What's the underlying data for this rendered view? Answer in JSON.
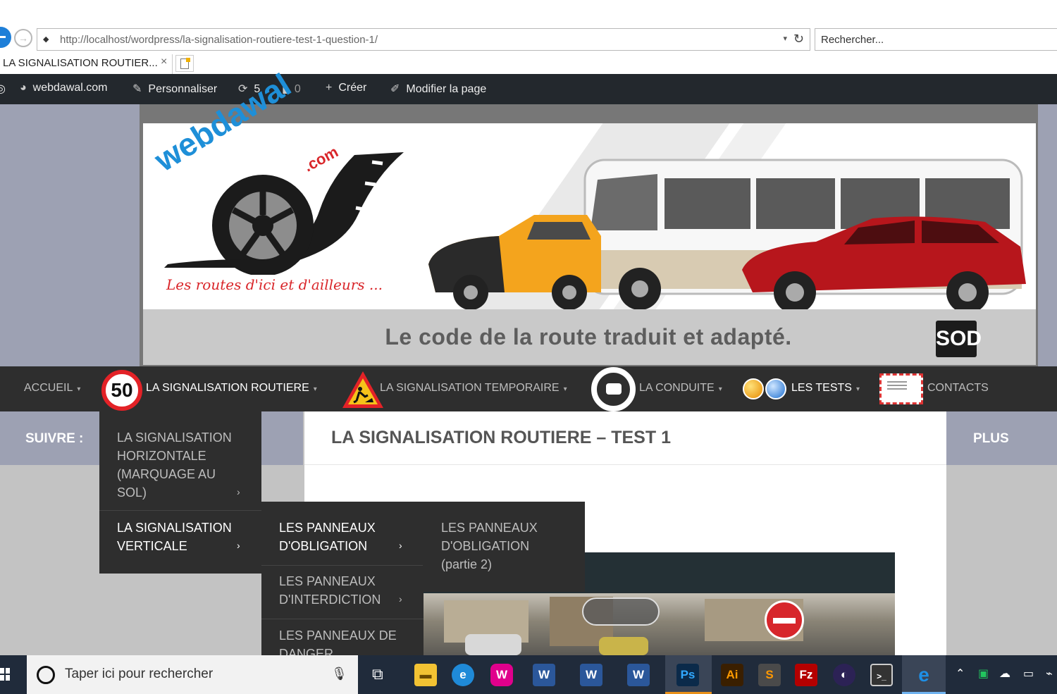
{
  "browser": {
    "url": "http://localhost/wordpress/la-signalisation-routiere-test-1-question-1/",
    "search_placeholder": "Rechercher...",
    "tab_title": "LA SIGNALISATION ROUTIER...",
    "tab_close": "×",
    "dropdown_glyph": "▾",
    "refresh_glyph": "↻",
    "forward_glyph": "→"
  },
  "admin_bar": {
    "site": "webdawal.com",
    "customize": "Personnaliser",
    "updates": "5",
    "comments": "0",
    "create": "Créer",
    "edit_page": "Modifier la page",
    "icons": [
      "dashboard-icon",
      "brush-icon",
      "update-icon",
      "comment-icon",
      "plus-icon",
      "pencil-icon"
    ]
  },
  "header": {
    "logo_text": "webdawal",
    "logo_domain": ".com",
    "slogan": "Les routes d'ici et d'ailleurs ...",
    "tagline": "Le code de la route traduit et adapté.",
    "badge": "SOD"
  },
  "nav": {
    "accueil": "ACCUEIL",
    "signalisation": "LA SIGNALISATION ROUTIERE",
    "speed_sign": "50",
    "temporaire": "LA SIGNALISATION TEMPORAIRE",
    "conduite": "LA CONDUITE",
    "tests": "LES TESTS",
    "contacts": "CONTACTS"
  },
  "subbar": {
    "follow": "SUIVRE :",
    "plus": "PLUS"
  },
  "page_title": "LA SIGNALISATION ROUTIERE – TEST 1",
  "menus": {
    "level1": [
      {
        "label": "LA SIGNALISATION HORIZONTALE (MARQUAGE AU SOL)"
      },
      {
        "label": "LA SIGNALISATION VERTICALE"
      }
    ],
    "level2": [
      {
        "label": "LES PANNEAUX D'OBLIGATION"
      },
      {
        "label": "LES PANNEAUX D'INTERDICTION"
      },
      {
        "label": "LES PANNEAUX DE DANGER"
      }
    ],
    "level3": [
      {
        "label": "LES PANNEAUX D'OBLIGATION (partie 2)"
      }
    ]
  },
  "taskbar": {
    "search_placeholder": "Taper ici pour rechercher",
    "apps": [
      "W",
      "W",
      "W",
      "Ps",
      "Ai",
      "S",
      "Fz"
    ],
    "colors": {
      "word": "#2b579a",
      "photoshop": "#0b2a4a",
      "illustrator": "#3a1f00",
      "filezilla": "#b40000",
      "sublime": "#4a4a4a"
    }
  },
  "colors": {
    "nav_bg": "#2e2e2e",
    "side_bg": "#9da1b3",
    "admin_bg": "#23282d",
    "speed_red": "#e32227"
  }
}
